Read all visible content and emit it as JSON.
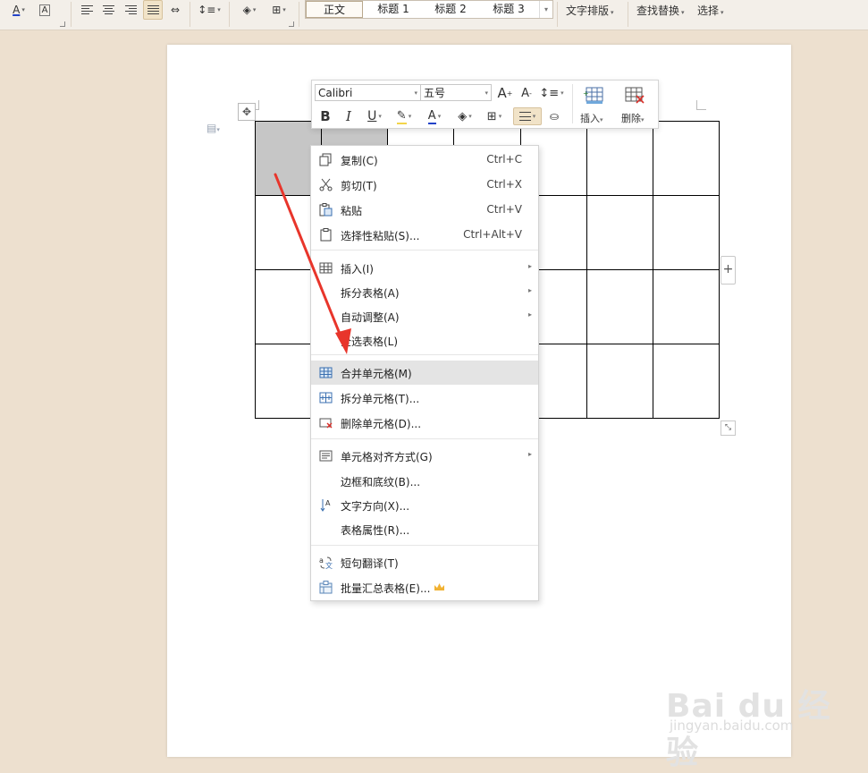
{
  "ribbon": {
    "styles": [
      "正文",
      "标题 1",
      "标题 2",
      "标题 3"
    ],
    "text_layout": "文字排版",
    "find_replace": "查找替换",
    "select": "选择"
  },
  "mini_toolbar": {
    "font_name": "Calibri",
    "font_size": "五号",
    "bold": "B",
    "italic": "I",
    "underline": "U",
    "font_color_letter": "A",
    "grow_font": "A",
    "shrink_font": "A",
    "insert_label": "插入",
    "delete_label": "删除"
  },
  "context_menu": {
    "items": [
      {
        "label": "复制(C)",
        "shortcut": "Ctrl+C",
        "icon": "copy-icon"
      },
      {
        "label": "剪切(T)",
        "shortcut": "Ctrl+X",
        "icon": "scissors-icon"
      },
      {
        "label": "粘贴",
        "shortcut": "Ctrl+V",
        "icon": "paste-icon"
      },
      {
        "label": "选择性粘贴(S)...",
        "shortcut": "Ctrl+Alt+V",
        "icon": "paste-special-icon"
      },
      {
        "label": "插入(I)",
        "icon": "table-insert-icon",
        "submenu": true
      },
      {
        "label": "拆分表格(A)",
        "submenu": true
      },
      {
        "label": "自动调整(A)",
        "submenu": true
      },
      {
        "label": "全选表格(L)"
      },
      {
        "label": "合并单元格(M)",
        "icon": "merge-cells-icon",
        "highlighted": true
      },
      {
        "label": "拆分单元格(T)...",
        "icon": "split-cells-icon"
      },
      {
        "label": "删除单元格(D)...",
        "icon": "delete-cells-icon"
      },
      {
        "label": "单元格对齐方式(G)",
        "icon": "cell-align-icon",
        "submenu": true
      },
      {
        "label": "边框和底纹(B)..."
      },
      {
        "label": "文字方向(X)...",
        "icon": "text-direction-icon"
      },
      {
        "label": "表格属性(R)..."
      },
      {
        "label": "短句翻译(T)",
        "icon": "translate-icon"
      },
      {
        "label": "批量汇总表格(E)...",
        "icon": "batch-summary-icon",
        "badge": "crown-icon"
      }
    ]
  },
  "table": {
    "rows": 4,
    "cols": 7,
    "selected_cells": [
      [
        0,
        0
      ],
      [
        0,
        1
      ]
    ]
  },
  "watermark": {
    "logo_text": "Bai du 经验",
    "url": "jingyan.baidu.com"
  },
  "colors": {
    "accent_arrow": "#e8352b",
    "highlight_row": "#e4e4e4",
    "selected_cell": "#c6c6c6",
    "background": "#ede0cf"
  }
}
